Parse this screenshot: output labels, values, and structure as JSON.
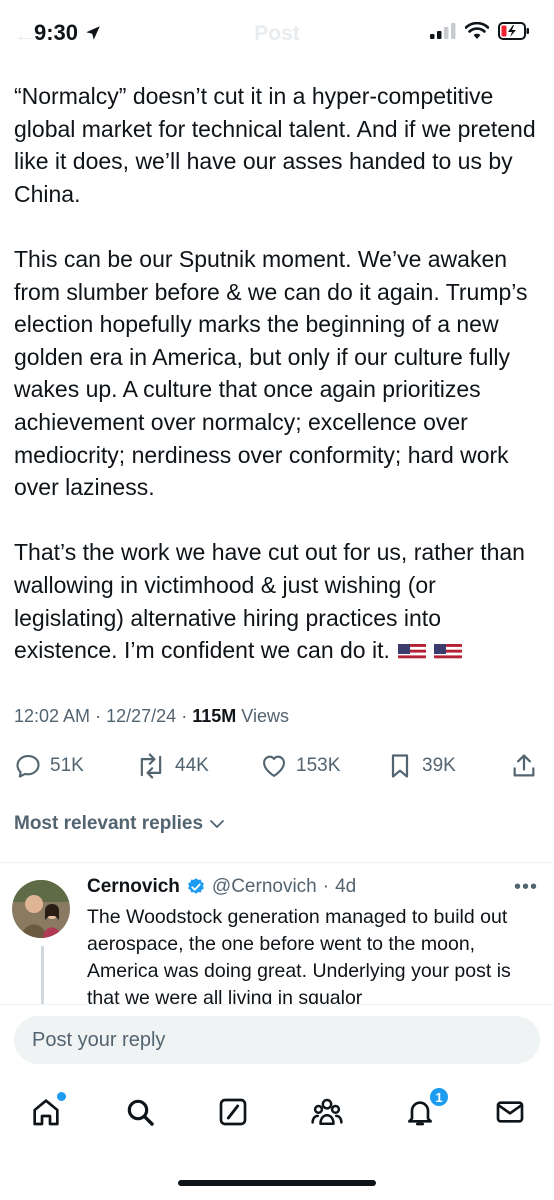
{
  "status_bar": {
    "time": "9:30",
    "ghost_back": "←",
    "ghost_title": "Post"
  },
  "tweet": {
    "paragraphs": [
      "“Normalcy” doesn’t cut it in a hyper-competitive global market for technical talent. And if we pretend like it does, we’ll have our asses handed to us by China.",
      "This can be our Sputnik moment. We’ve awaken from slumber before & we can do it again. Trump’s election hopefully marks the beginning of a new golden era in America, but only if our culture fully wakes up. A culture that once again prioritizes achievement over normalcy; excellence over mediocrity; nerdiness over conformity; hard work over laziness.",
      "That’s the work we have cut out for us, rather than wallowing in victimhood & just wishing (or legislating) alternative hiring practices into existence. I’m confident we can do it."
    ],
    "emoji": [
      "us-flag",
      "us-flag"
    ],
    "time": "12:02 AM",
    "date": "12/27/24",
    "separator": "·",
    "views_count": "115M",
    "views_label": "Views"
  },
  "actions": {
    "replies": "51K",
    "reposts": "44K",
    "likes": "153K",
    "bookmarks": "39K"
  },
  "replies_filter": {
    "label": "Most relevant replies"
  },
  "reply": {
    "name": "Cernovich",
    "handle": "@Cernovich",
    "separator": "·",
    "age": "4d",
    "text": "The Woodstock generation managed to build out aerospace, the one before went to the moon, America was doing great. Underlying your post is that we were all living in squalor"
  },
  "composer": {
    "placeholder": "Post your reply"
  },
  "nav": {
    "notifications_badge": "1"
  },
  "colors": {
    "accent": "#1d9bf0",
    "text": "#0f1419",
    "muted": "#536471",
    "battery_low": "#f4212e"
  }
}
